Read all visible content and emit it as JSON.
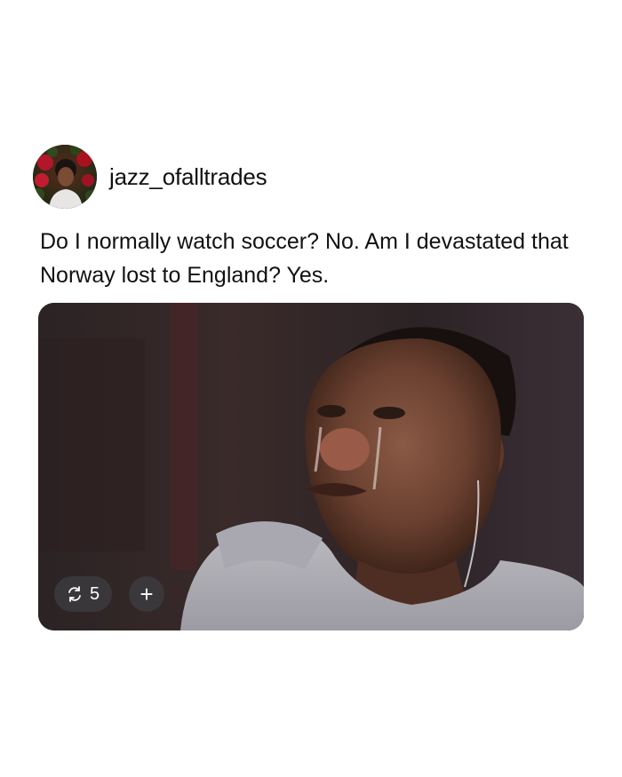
{
  "post": {
    "username": "jazz_ofalltrades",
    "text": "Do I normally watch soccer? No. Am I devastated that Norway lost to England? Yes.",
    "media": {
      "description_icon": "crying-man-photo",
      "repost_count": "5",
      "add_label": "+"
    }
  },
  "colors": {
    "background": "#ffffff",
    "text": "#111111",
    "chip_background": "#3c3c40",
    "chip_text": "#ffffff"
  },
  "icons": {
    "repost": "repost-icon",
    "add": "plus-icon"
  }
}
